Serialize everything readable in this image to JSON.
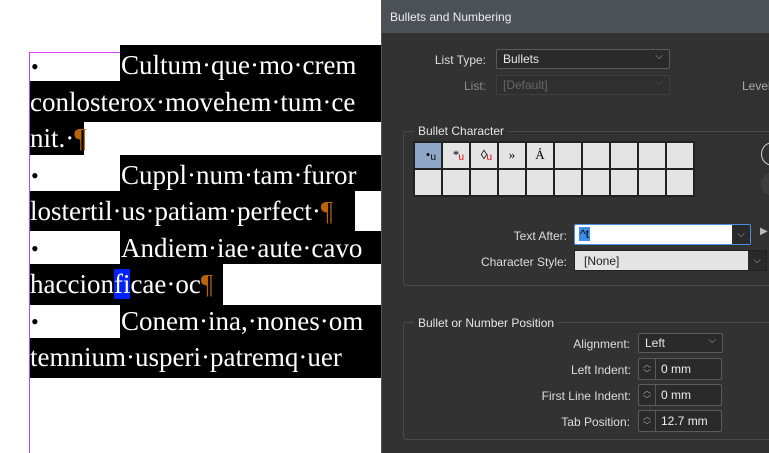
{
  "document": {
    "bullet": "•",
    "pilcrow": "¶",
    "lines": [
      "Cultum·que·mo·crem",
      "conlosterox·movehem·tum·ce",
      "nit.·",
      "Cuppl·num·tam·furor",
      "lostertil·us·patiam·perfect·",
      "Andiem·iae·aute·cavo",
      "haccion",
      "fi",
      "cae·oc",
      "Conem·ina,·nones·om",
      "temnium·usperi·patremq·uer"
    ]
  },
  "dialog": {
    "title": "Bullets and Numbering",
    "list_type_label": "List Type:",
    "list_type_value": "Bullets",
    "list_label": "List:",
    "list_value": "[Default]",
    "level_label": "Level",
    "bullet_character_title": "Bullet Character",
    "bullets": [
      {
        "glyph": "•",
        "sub": "u"
      },
      {
        "glyph": "*",
        "sub": "u"
      },
      {
        "glyph": "◊",
        "sub": "u"
      },
      {
        "glyph": "»",
        "sub": ""
      },
      {
        "glyph": "Ả",
        "sub": ""
      }
    ],
    "text_after_label": "Text After:",
    "text_after_value": "^t",
    "character_style_label": "Character Style:",
    "character_style_value": "[None]",
    "position_title": "Bullet or Number Position",
    "alignment_label": "Alignment:",
    "alignment_value": "Left",
    "left_indent_label": "Left Indent:",
    "left_indent_value": "0 mm",
    "first_line_indent_label": "First Line Indent:",
    "first_line_indent_value": "0 mm",
    "tab_position_label": "Tab Position:",
    "tab_position_value": "12.7 mm"
  }
}
